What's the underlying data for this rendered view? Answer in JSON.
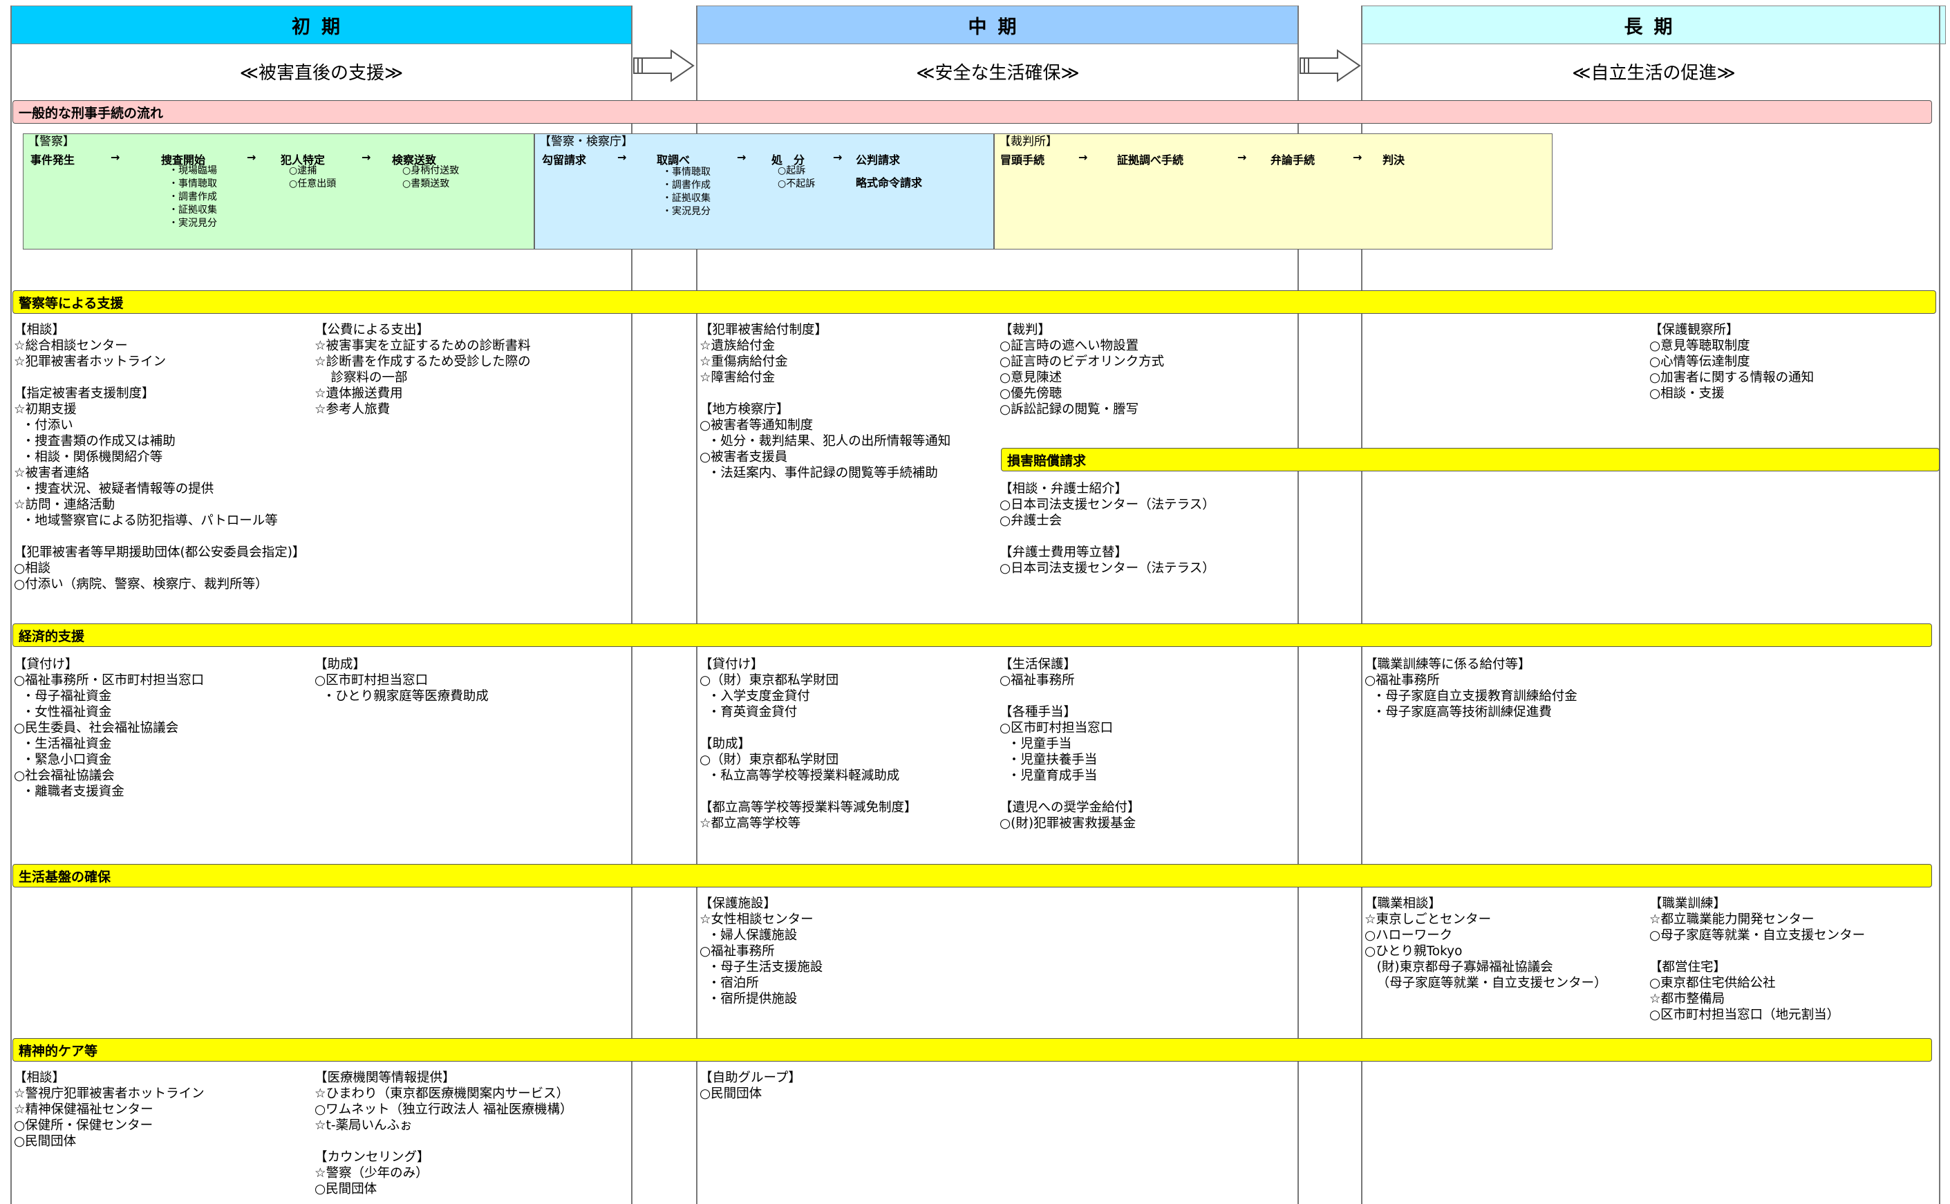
{
  "phases": [
    {
      "title": "初期",
      "subtitle": "≪被害直後の支援≫",
      "color": "#00ccff"
    },
    {
      "title": "中期",
      "subtitle": "≪安全な生活確保≫",
      "color": "#99ccff"
    },
    {
      "title": "長期",
      "subtitle": "≪自立生活の促進≫",
      "color": "#ccffff"
    }
  ],
  "flow": {
    "band": "一般的な刑事手続の流れ",
    "police": {
      "header": "【警察】",
      "steps": [
        "事件発生",
        "捜査開始",
        "犯人特定",
        "検察送致"
      ],
      "arrow": "→",
      "investigation_details": "・現場臨場\n・事情聴取\n・調書作成\n・証拠収集\n・実況見分",
      "arrest_details": "○逮捕\n○任意出頭",
      "send_details": "○身柄付送致\n○書類送致"
    },
    "prosecution": {
      "header": "【警察・検察庁】",
      "steps": [
        "勾留請求",
        "取調べ",
        "処　分",
        "公判請求",
        "略式命令請求"
      ],
      "interrogation_details": "・事情聴取\n・調書作成\n・証拠収集\n・実況見分",
      "disposition_details": "○起訴\n○不起訴"
    },
    "court": {
      "header": "【裁判所】",
      "steps": [
        "冒頭手続",
        "証拠調べ手続",
        "弁論手続",
        "判決"
      ]
    }
  },
  "sections": {
    "police_support": {
      "band": "警察等による支援",
      "col1": "【相談】\n☆総合相談センター\n☆犯罪被害者ホットライン\n\n【指定被害者支援制度】\n☆初期支援\n  ・付添い\n  ・捜査書類の作成又は補助\n  ・相談・関係機関紹介等\n☆被害者連絡\n  ・捜査状況、被疑者情報等の提供\n☆訪問・連絡活動\n  ・地域警察官による防犯指導、パトロール等\n\n【犯罪被害者等早期援助団体(都公安委員会指定)】\n○相談\n○付添い（病院、警察、検察庁、裁判所等）",
      "col2": "【公費による支出】\n☆被害事実を立証するための診断書料\n☆診断書を作成するため受診した際の\n    診察料の一部\n☆遺体搬送費用\n☆参考人旅費",
      "col3": "【犯罪被害給付制度】\n☆遺族給付金\n☆重傷病給付金\n☆障害給付金\n\n【地方検察庁】\n○被害者等通知制度\n  ・処分・裁判結果、犯人の出所情報等通知\n○被害者支援員\n  ・法廷案内、事件記録の閲覧等手続補助",
      "col4": "【裁判】\n○証言時の遮へい物設置\n○証言時のビデオリンク方式\n○意見陳述\n○優先傍聴\n○訴訟記録の閲覧・謄写",
      "col5": "【保護観察所】\n○意見等聴取制度\n○心情等伝達制度\n○加害者に関する情報の通知\n○相談・支援"
    },
    "damages": {
      "band": "損害賠償請求",
      "text": "【相談・弁護士紹介】\n○日本司法支援センター（法テラス）\n○弁護士会\n\n【弁護士費用等立替】\n○日本司法支援センター（法テラス）"
    },
    "economic": {
      "band": "経済的支援",
      "col1": "【貸付け】\n○福祉事務所・区市町村担当窓口\n  ・母子福祉資金\n  ・女性福祉資金\n○民生委員、社会福祉協議会\n  ・生活福祉資金\n  ・緊急小口資金\n○社会福祉協議会\n  ・離職者支援資金",
      "col2": "【助成】\n○区市町村担当窓口\n  ・ひとり親家庭等医療費助成",
      "col3": "【貸付け】\n○（財）東京都私学財団\n  ・入学支度金貸付\n  ・育英資金貸付\n\n【助成】\n○（財）東京都私学財団\n  ・私立高等学校等授業料軽減助成\n\n【都立高等学校等授業料等減免制度】\n☆都立高等学校等",
      "col4": "【生活保護】\n○福祉事務所\n\n【各種手当】\n○区市町村担当窓口\n  ・児童手当\n  ・児童扶養手当\n  ・児童育成手当\n\n【遺児への奨学金給付】\n○(財)犯罪被害救援基金",
      "col5": "【職業訓練等に係る給付等】\n○福祉事務所\n  ・母子家庭自立支援教育訓練給付金\n  ・母子家庭高等技術訓練促進費"
    },
    "livelihood": {
      "band": "生活基盤の確保",
      "col3": "【保護施設】\n☆女性相談センター\n  ・婦人保護施設\n○福祉事務所\n  ・母子生活支援施設\n  ・宿泊所\n  ・宿所提供施設",
      "col5": "【職業相談】\n☆東京しごとセンター\n○ハローワーク\n○ひとり親Tokyo\n   (財)東京都母子寡婦福祉協議会\n   （母子家庭等就業・自立支援センター）",
      "col6": "【職業訓練】\n☆都立職業能力開発センター\n○母子家庭等就業・自立支援センター\n\n【都営住宅】\n○東京都住宅供給公社\n☆都市整備局\n○区市町村担当窓口（地元割当）"
    },
    "mental": {
      "band": "精神的ケア等",
      "col1": "【相談】\n☆警視庁犯罪被害者ホットライン\n☆精神保健福祉センター\n○保健所・保健センター\n○民間団体",
      "col2": "【医療機関等情報提供】\n☆ひまわり（東京都医療機関案内サービス）\n○ワムネット（独立行政法人 福祉医療機構）\n☆t-薬局いんふぉ\n\n【カウンセリング】\n☆警察（少年のみ）\n○民間団体",
      "col3": "【自助グループ】\n○民間団体"
    }
  }
}
